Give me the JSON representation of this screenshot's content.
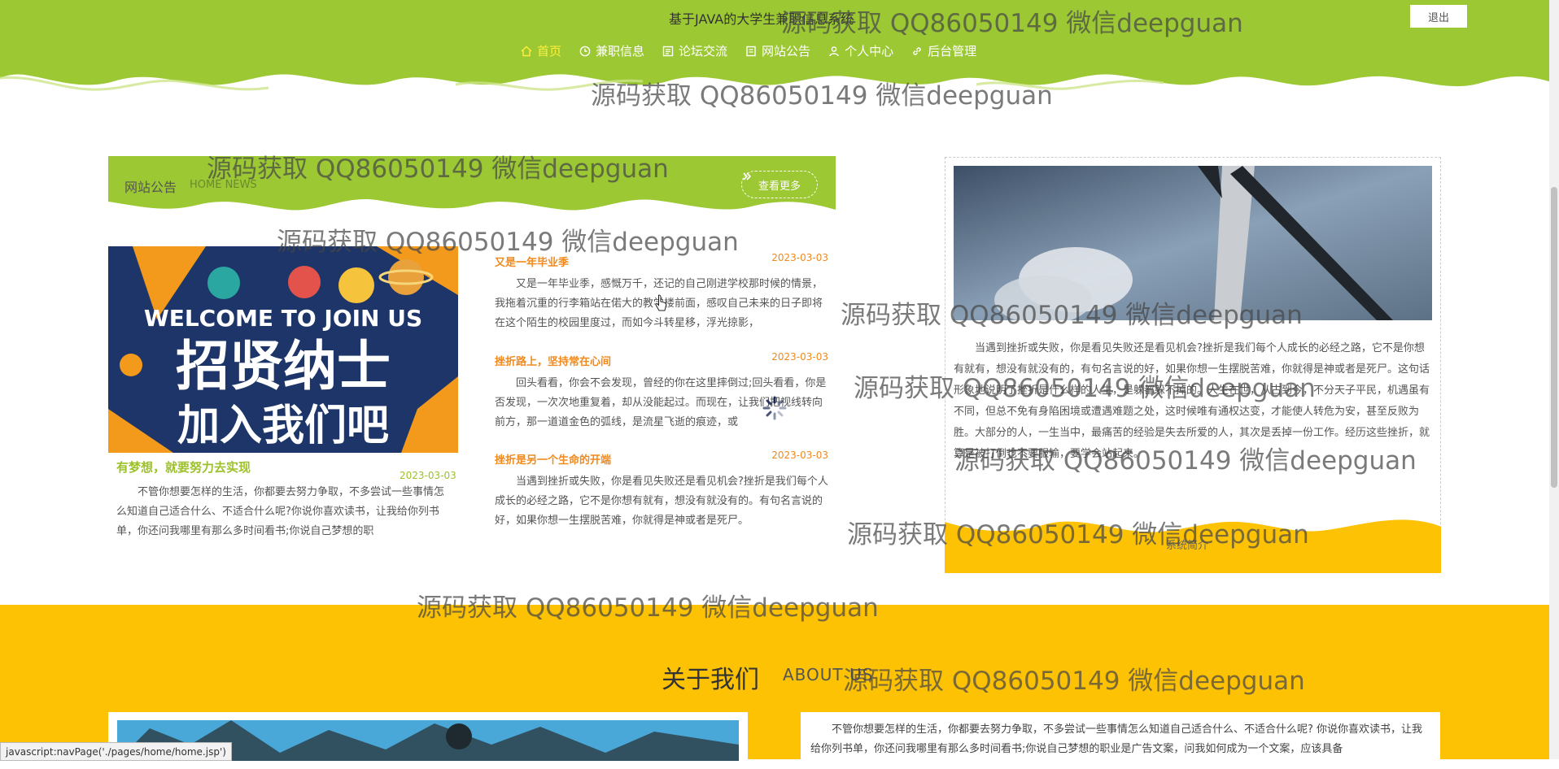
{
  "header": {
    "site_title": "基于JAVA的大学生兼职信息系统",
    "logout_label": "退出",
    "nav": [
      {
        "label": "首页",
        "icon": "home-icon",
        "active": true
      },
      {
        "label": "兼职信息",
        "icon": "clock-icon"
      },
      {
        "label": "论坛交流",
        "icon": "forum-icon"
      },
      {
        "label": "网站公告",
        "icon": "notice-icon"
      },
      {
        "label": "个人中心",
        "icon": "user-icon"
      },
      {
        "label": "后台管理",
        "icon": "link-icon"
      }
    ]
  },
  "watermark": "源码获取 QQ86050149 微信deepguan",
  "news": {
    "title": "网站公告",
    "subtitle": "HOME NEWS",
    "more_label": "查看更多",
    "featured": {
      "image_text_line1": "WELCOME TO JOIN US",
      "image_text_line2": "招贤纳士",
      "image_text_line3": "加入我们吧",
      "title": "有梦想，就要努力去实现",
      "date": "2023-03-03",
      "text": "不管你想要怎样的生活，你都要去努力争取，不多尝试一些事情怎么知道自己适合什么、不适合什么呢?你说你喜欢读书，让我给你列书单，你还问我哪里有那么多时间看书;你说自己梦想的职"
    },
    "items": [
      {
        "title": "又是一年毕业季",
        "date": "2023-03-03",
        "text": "又是一年毕业季，感慨万千，还记的自己刚进学校那时候的情景，我拖着沉重的行李箱站在偌大的教学楼前面，感叹自己未来的日子即将在这个陌生的校园里度过，而如今斗转星移，浮光掠影，"
      },
      {
        "title": "挫折路上，坚持常在心间",
        "date": "2023-03-03",
        "text": "回头看看，你会不会发现，曾经的你在这里摔倒过;回头看看，你是否发现，一次次地重复着，却从没能起过。而现在，让我们把视线转向前方，那一道道金色的弧线，是流星飞逝的痕迹，或"
      },
      {
        "title": "挫折是另一个生命的开端",
        "date": "2023-03-03",
        "text": "当遇到挫折或失败，你是看见失败还是看见机会?挫折是我们每个人成长的必经之路，它不是你想有就有，想没有就没有的。有句名言说的好，如果你想一生摆脱苦难，你就得是神或者是死尸。"
      }
    ]
  },
  "intro": {
    "text": "当遇到挫折或失败，你是看见失败还是看见机会?挫折是我们每个人成长的必经之路，它不是你想有就有，想没有就没有的，有句名言说的好，如果你想一生摆脱苦难，你就得是神或者是死尸。这句话形象地说明了挫折是什么样的人生，是躲都躲不掉的。人生在世，从古到今，不分天子平民，机遇虽有不同，但总不免有身陷困境或遭遇难题之处，这时候唯有通权达变，才能使人转危为安，甚至反败为胜。大部分的人，一生当中，最痛苦的经验是失去所爱的人，其次是丢掉一份工作。经历这些挫折，就算是被打倒也不要服输，要学会站起来。",
    "banner_label": "系统简介"
  },
  "about": {
    "title": "关于我们",
    "subtitle": "ABOUT US",
    "text": "不管你想要怎样的生活，你都要去努力争取，不多尝试一些事情怎么知道自己适合什么、不适合什么呢? 你说你喜欢读书，让我给你列书单，你还问我哪里有那么多时间看书;你说自己梦想的职业是广告文案，问我如何成为一个文案，应该具备"
  },
  "status_bar": "javascript:navPage('./pages/home/home.jsp')",
  "colors": {
    "header_green": "#9cc834",
    "accent_yellow": "#fdc204",
    "active_nav": "#ffef3a",
    "news_orange": "#f08a1e"
  }
}
